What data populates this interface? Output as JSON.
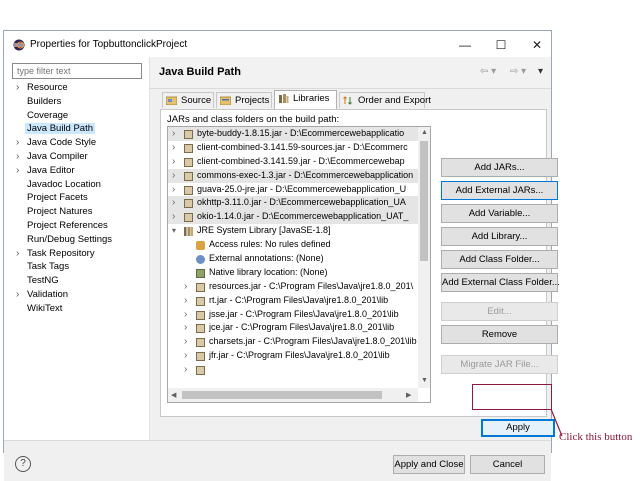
{
  "window": {
    "title": "Properties for TopbuttonclickProject",
    "minimize_glyph": "—",
    "maximize_glyph": "☐",
    "close_glyph": "✕"
  },
  "filter": {
    "placeholder": "type filter text"
  },
  "nav": {
    "items": [
      {
        "label": "Resource",
        "arrow": true
      },
      {
        "label": "Builders",
        "arrow": false
      },
      {
        "label": "Coverage",
        "arrow": false
      },
      {
        "label": "Java Build Path",
        "arrow": false,
        "selected": true
      },
      {
        "label": "Java Code Style",
        "arrow": true
      },
      {
        "label": "Java Compiler",
        "arrow": true
      },
      {
        "label": "Java Editor",
        "arrow": true
      },
      {
        "label": "Javadoc Location",
        "arrow": false
      },
      {
        "label": "Project Facets",
        "arrow": false
      },
      {
        "label": "Project Natures",
        "arrow": false
      },
      {
        "label": "Project References",
        "arrow": false
      },
      {
        "label": "Run/Debug Settings",
        "arrow": false
      },
      {
        "label": "Task Repository",
        "arrow": true
      },
      {
        "label": "Task Tags",
        "arrow": false
      },
      {
        "label": "TestNG",
        "arrow": false
      },
      {
        "label": "Validation",
        "arrow": true
      },
      {
        "label": "WikiText",
        "arrow": false
      }
    ]
  },
  "header": {
    "title": "Java Build Path"
  },
  "tabs": [
    {
      "label": "Source",
      "icon": "source-folder-icon"
    },
    {
      "label": "Projects",
      "icon": "projects-icon"
    },
    {
      "label": "Libraries",
      "icon": "libraries-icon",
      "active": true
    },
    {
      "label": "Order and Export",
      "icon": "order-export-icon"
    }
  ],
  "libraries": {
    "caption": "JARs and class folders on the build path:",
    "rows": [
      {
        "text": "byte-buddy-1.8.15.jar - D:\\Ecommercewebapplicatio",
        "level": 0,
        "expander": true,
        "icon": "jar-icon",
        "highlight": true
      },
      {
        "text": "client-combined-3.141.59-sources.jar - D:\\Ecommerc",
        "level": 0,
        "expander": true,
        "icon": "jar-icon"
      },
      {
        "text": "client-combined-3.141.59.jar - D:\\Ecommercewebap",
        "level": 0,
        "expander": true,
        "icon": "jar-icon"
      },
      {
        "text": "commons-exec-1.3.jar - D:\\Ecommercewebapplication",
        "level": 0,
        "expander": true,
        "icon": "jar-icon",
        "highlight": true
      },
      {
        "text": "guava-25.0-jre.jar - D:\\Ecommercewebapplication_U",
        "level": 0,
        "expander": true,
        "icon": "jar-icon"
      },
      {
        "text": "okhttp-3.11.0.jar - D:\\Ecommercewebapplication_UA",
        "level": 0,
        "expander": true,
        "icon": "jar-icon",
        "highlight": true
      },
      {
        "text": "okio-1.14.0.jar - D:\\Ecommercewebapplication_UAT_",
        "level": 0,
        "expander": true,
        "icon": "jar-icon",
        "highlight": true
      },
      {
        "text": "JRE System Library [JavaSE-1.8]",
        "level": 0,
        "expander": true,
        "expanded": true,
        "icon": "library-icon"
      },
      {
        "text": "Access rules: No rules defined",
        "level": 1,
        "expander": false,
        "icon": "access-rules-icon"
      },
      {
        "text": "External annotations: (None)",
        "level": 1,
        "expander": false,
        "icon": "annotations-icon"
      },
      {
        "text": "Native library location: (None)",
        "level": 1,
        "expander": false,
        "icon": "native-library-icon"
      },
      {
        "text": "resources.jar - C:\\Program Files\\Java\\jre1.8.0_201\\",
        "level": 1,
        "expander": true,
        "icon": "jar-icon"
      },
      {
        "text": "rt.jar - C:\\Program Files\\Java\\jre1.8.0_201\\lib",
        "level": 1,
        "expander": true,
        "icon": "jar-icon"
      },
      {
        "text": "jsse.jar - C:\\Program Files\\Java\\jre1.8.0_201\\lib",
        "level": 1,
        "expander": true,
        "icon": "jar-icon"
      },
      {
        "text": "jce.jar - C:\\Program Files\\Java\\jre1.8.0_201\\lib",
        "level": 1,
        "expander": true,
        "icon": "jar-icon"
      },
      {
        "text": "charsets.jar - C:\\Program Files\\Java\\jre1.8.0_201\\lib",
        "level": 1,
        "expander": true,
        "icon": "jar-icon"
      },
      {
        "text": "jfr.jar - C:\\Program Files\\Java\\jre1.8.0_201\\lib",
        "level": 1,
        "expander": true,
        "icon": "jar-icon"
      },
      {
        "text": "",
        "level": 1,
        "expander": true,
        "icon": "jar-icon"
      }
    ]
  },
  "buttons": {
    "add_jars": "Add JARs...",
    "add_external_jars": "Add External JARs...",
    "add_variable": "Add Variable...",
    "add_library": "Add Library...",
    "add_class_folder": "Add Class Folder...",
    "add_external_class_folder": "Add External Class Folder...",
    "edit": "Edit...",
    "remove": "Remove",
    "migrate_jar": "Migrate JAR File...",
    "apply": "Apply",
    "apply_and_close": "Apply and Close",
    "cancel": "Cancel",
    "help_glyph": "?"
  },
  "annotation": {
    "text": "Click this button",
    "color": "#8c1a3a"
  },
  "colors": {
    "selection": "#cce8ff",
    "focus": "#0078d7",
    "annotation": "#8c1a3a"
  }
}
